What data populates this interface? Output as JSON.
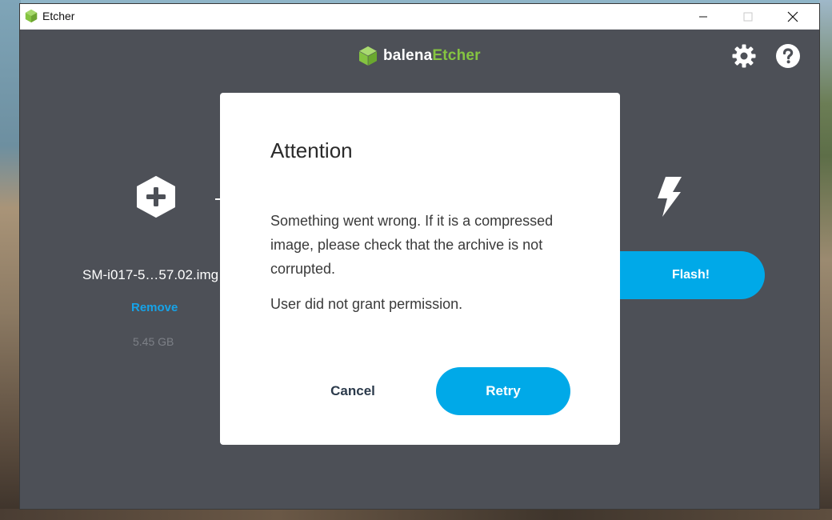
{
  "window": {
    "title": "Etcher",
    "controls": [
      "minimize",
      "maximize",
      "close"
    ]
  },
  "header": {
    "brand_prefix": "balena",
    "brand_suffix": "Etcher",
    "icons": [
      "settings-icon",
      "help-icon"
    ]
  },
  "image_step": {
    "filename": "SM-i017-5…57.02.img",
    "remove_label": "Remove",
    "size": "5.45 GB"
  },
  "flash_step": {
    "button_label": "Flash!"
  },
  "dialog": {
    "title": "Attention",
    "message": "Something went wrong. If it is a compressed image, please check that the archive is not corrupted.",
    "detail": "User did not grant permission.",
    "cancel_label": "Cancel",
    "retry_label": "Retry"
  },
  "colors": {
    "accent": "#00a9e8",
    "brand_green": "#85c441",
    "background": "#4d5057"
  }
}
